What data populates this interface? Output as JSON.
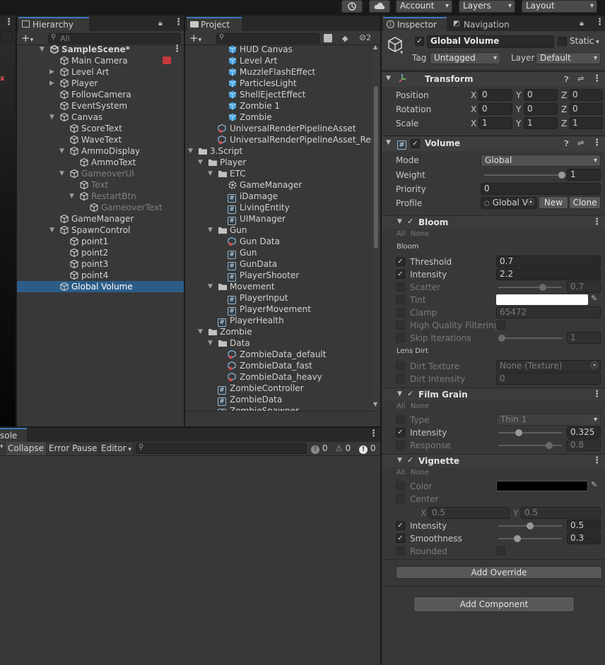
{
  "top_bar": {
    "account": "Account",
    "layers": "Layers",
    "layout": "Layout"
  },
  "hierarchy": {
    "tab_label": "Hierarchy",
    "search_placeholder": "All",
    "rows": [
      {
        "label": "SampleScene*",
        "depth": 0,
        "caret": "open",
        "icon": "scene",
        "bold": true
      },
      {
        "label": "Main Camera",
        "depth": 1,
        "caret": "",
        "icon": "cube"
      },
      {
        "label": "Level Art",
        "depth": 1,
        "caret": "closed",
        "icon": "cube"
      },
      {
        "label": "Player",
        "depth": 1,
        "caret": "closed",
        "icon": "cube"
      },
      {
        "label": "FollowCamera",
        "depth": 1,
        "caret": "",
        "icon": "cube"
      },
      {
        "label": "EventSystem",
        "depth": 1,
        "caret": "",
        "icon": "cube"
      },
      {
        "label": "Canvas",
        "depth": 1,
        "caret": "open",
        "icon": "cube"
      },
      {
        "label": "ScoreText",
        "depth": 2,
        "caret": "",
        "icon": "cube"
      },
      {
        "label": "WaveText",
        "depth": 2,
        "caret": "",
        "icon": "cube"
      },
      {
        "label": "AmmoDisplay",
        "depth": 2,
        "caret": "open",
        "icon": "cube"
      },
      {
        "label": "AmmoText",
        "depth": 3,
        "caret": "",
        "icon": "cube"
      },
      {
        "label": "GameoverUI",
        "depth": 2,
        "caret": "open",
        "icon": "cube",
        "dim": true
      },
      {
        "label": "Text",
        "depth": 3,
        "caret": "",
        "icon": "cube",
        "dim": true
      },
      {
        "label": "RestartBtn",
        "depth": 3,
        "caret": "open",
        "icon": "cube",
        "dim": true
      },
      {
        "label": "GameoverText",
        "depth": 4,
        "caret": "",
        "icon": "cube",
        "dim": true
      },
      {
        "label": "GameManager",
        "depth": 1,
        "caret": "",
        "icon": "cube"
      },
      {
        "label": "SpawnControl",
        "depth": 1,
        "caret": "open",
        "icon": "cube"
      },
      {
        "label": "point1",
        "depth": 2,
        "caret": "",
        "icon": "cube"
      },
      {
        "label": "point2",
        "depth": 2,
        "caret": "",
        "icon": "cube"
      },
      {
        "label": "point3",
        "depth": 2,
        "caret": "",
        "icon": "cube"
      },
      {
        "label": "point4",
        "depth": 2,
        "caret": "",
        "icon": "cube"
      },
      {
        "label": "Global Volume",
        "depth": 1,
        "caret": "",
        "icon": "cube",
        "selected": true
      }
    ]
  },
  "project": {
    "tab_label": "Project",
    "hidden_count": "2",
    "rows": [
      {
        "label": "HUD Canvas",
        "depth": 3,
        "caret": "",
        "icon": "prefab"
      },
      {
        "label": "Level Art",
        "depth": 3,
        "caret": "",
        "icon": "prefab"
      },
      {
        "label": "MuzzleFlashEffect",
        "depth": 3,
        "caret": "",
        "icon": "prefab"
      },
      {
        "label": "ParticlesLight",
        "depth": 3,
        "caret": "",
        "icon": "prefab"
      },
      {
        "label": "ShellEjectEffect",
        "depth": 3,
        "caret": "",
        "icon": "prefab"
      },
      {
        "label": "Zombie 1",
        "depth": 3,
        "caret": "",
        "icon": "prefab"
      },
      {
        "label": "Zombie",
        "depth": 3,
        "caret": "",
        "icon": "prefab"
      },
      {
        "label": "UniversalRenderPipelineAsset",
        "depth": 2,
        "caret": "",
        "icon": "asset"
      },
      {
        "label": "UniversalRenderPipelineAsset_Renc",
        "depth": 2,
        "caret": "",
        "icon": "asset"
      },
      {
        "label": "3.Script",
        "depth": 0,
        "caret": "open",
        "icon": "folder"
      },
      {
        "label": "Player",
        "depth": 1,
        "caret": "open",
        "icon": "folder"
      },
      {
        "label": "ETC",
        "depth": 2,
        "caret": "open",
        "icon": "folder"
      },
      {
        "label": "GameManager",
        "depth": 3,
        "caret": "",
        "icon": "gear"
      },
      {
        "label": "iDamage",
        "depth": 3,
        "caret": "",
        "icon": "script"
      },
      {
        "label": "LivingEntity",
        "depth": 3,
        "caret": "",
        "icon": "script"
      },
      {
        "label": "UIManager",
        "depth": 3,
        "caret": "",
        "icon": "script"
      },
      {
        "label": "Gun",
        "depth": 2,
        "caret": "open",
        "icon": "folder"
      },
      {
        "label": "Gun Data",
        "depth": 3,
        "caret": "",
        "icon": "asset"
      },
      {
        "label": "Gun",
        "depth": 3,
        "caret": "",
        "icon": "script"
      },
      {
        "label": "GunData",
        "depth": 3,
        "caret": "",
        "icon": "script"
      },
      {
        "label": "PlayerShooter",
        "depth": 3,
        "caret": "",
        "icon": "script"
      },
      {
        "label": "Movement",
        "depth": 2,
        "caret": "open",
        "icon": "folder"
      },
      {
        "label": "PlayerInput",
        "depth": 3,
        "caret": "",
        "icon": "script"
      },
      {
        "label": "PlayerMovement",
        "depth": 3,
        "caret": "",
        "icon": "script"
      },
      {
        "label": "PlayerHealth",
        "depth": 2,
        "caret": "",
        "icon": "script"
      },
      {
        "label": "Zombie",
        "depth": 1,
        "caret": "open",
        "icon": "folder"
      },
      {
        "label": "Data",
        "depth": 2,
        "caret": "open",
        "icon": "folder"
      },
      {
        "label": "ZombieData_default",
        "depth": 3,
        "caret": "",
        "icon": "asset"
      },
      {
        "label": "ZombieData_fast",
        "depth": 3,
        "caret": "",
        "icon": "asset"
      },
      {
        "label": "ZombieData_heavy",
        "depth": 3,
        "caret": "",
        "icon": "asset"
      },
      {
        "label": "ZombieController",
        "depth": 2,
        "caret": "",
        "icon": "script"
      },
      {
        "label": "ZombieData",
        "depth": 2,
        "caret": "",
        "icon": "script"
      },
      {
        "label": "ZombieSpawner",
        "depth": 2,
        "caret": "",
        "icon": "script"
      }
    ]
  },
  "console": {
    "tab_label": "sole",
    "collapse": "Collapse",
    "error_pause": "Error Pause",
    "editor": "Editor",
    "info_count": "0",
    "warn_count": "0",
    "error_count": "0"
  },
  "inspector": {
    "tab_label": "Inspector",
    "nav_tab_label": "Navigation",
    "object_name": "Global Volume",
    "static_label": "Static",
    "tag_label": "Tag",
    "tag_value": "Untagged",
    "layer_label": "Layer",
    "layer_value": "Default",
    "transform": {
      "title": "Transform",
      "position_label": "Position",
      "rotation_label": "Rotation",
      "scale_label": "Scale",
      "position": [
        "0",
        "0",
        "0"
      ],
      "rotation": [
        "0",
        "0",
        "0"
      ],
      "scale": [
        "1",
        "1",
        "1"
      ]
    },
    "volume": {
      "title": "Volume",
      "mode_label": "Mode",
      "mode_value": "Global",
      "weight_label": "Weight",
      "weight_value": "1",
      "weight_fraction": 1.0,
      "priority_label": "Priority",
      "priority_value": "0",
      "profile_label": "Profile",
      "profile_value": "Global V",
      "new_label": "New",
      "clone_label": "Clone"
    },
    "bloom": {
      "title": "Bloom",
      "all": "All",
      "none": "None",
      "section_bloom": "Bloom",
      "threshold_label": "Threshold",
      "threshold_value": "0.7",
      "intensity_label": "Intensity",
      "intensity_value": "2.2",
      "scatter_label": "Scatter",
      "scatter_value": "0.7",
      "scatter_fraction": 0.7,
      "tint_label": "Tint",
      "tint_color": "#ffffff",
      "clamp_label": "Clamp",
      "clamp_value": "65472",
      "hq_label": "High Quality Filtering",
      "skip_label": "Skip Iterations",
      "skip_value": "1",
      "skip_fraction": 0.06,
      "section_lens": "Lens Dirt",
      "dirt_texture_label": "Dirt Texture",
      "dirt_texture_value": "None (Texture)",
      "dirt_intensity_label": "Dirt Intensity",
      "dirt_intensity_value": "0"
    },
    "film_grain": {
      "title": "Film Grain",
      "all": "All",
      "none": "None",
      "type_label": "Type",
      "type_value": "Thin 1",
      "intensity_label": "Intensity",
      "intensity_value": "0.325",
      "intensity_fraction": 0.325,
      "response_label": "Response",
      "response_value": "0.8",
      "response_fraction": 0.8
    },
    "vignette": {
      "title": "Vignette",
      "all": "All",
      "none": "None",
      "color_label": "Color",
      "color_value": "#000000",
      "center_label": "Center",
      "center_x_label": "X",
      "center_x": "0.5",
      "center_y_label": "Y",
      "center_y": "0.5",
      "intensity_label": "Intensity",
      "intensity_value": "0.5",
      "intensity_fraction": 0.5,
      "smoothness_label": "Smoothness",
      "smoothness_value": "0.3",
      "smoothness_fraction": 0.3,
      "rounded_label": "Rounded"
    },
    "add_override": "Add Override",
    "add_component": "Add Component"
  }
}
